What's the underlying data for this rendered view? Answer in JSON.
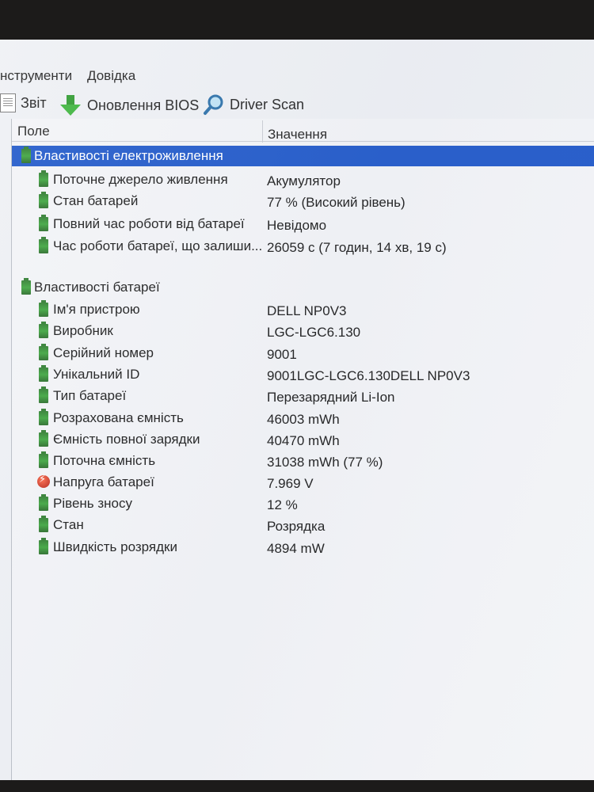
{
  "menu": {
    "tools": "нструменти",
    "help": "Довідка"
  },
  "toolbar": {
    "report": {
      "label": "Звіт",
      "icon": "report-icon"
    },
    "bios_update": {
      "label": "Оновлення BIOS",
      "icon": "download-arrow-icon"
    },
    "driver_scan": {
      "label": "Driver Scan",
      "icon": "magnifier-icon"
    }
  },
  "table": {
    "headers": {
      "field": "Поле",
      "value": "Значення"
    },
    "power_group": {
      "title": "Властивості електроживлення",
      "rows": [
        {
          "field": "Поточне джерело живлення",
          "value": "Акумулятор"
        },
        {
          "field": "Стан батарей",
          "value": "77 % (Високий рівень)"
        },
        {
          "field": "Повний час роботи від батареї",
          "value": "Невідомо"
        },
        {
          "field": "Час роботи батареї, що залиши...",
          "value": "26059 с (7 годин, 14 хв, 19 с)"
        }
      ]
    },
    "battery_group": {
      "title": "Властивості батареї",
      "rows": [
        {
          "field": "Ім'я пристрою",
          "value": "DELL NP0V3"
        },
        {
          "field": "Виробник",
          "value": "LGC-LGC6.130"
        },
        {
          "field": "Серійний номер",
          "value": "9001"
        },
        {
          "field": "Унікальний ID",
          "value": "9001LGC-LGC6.130DELL NP0V3"
        },
        {
          "field": "Тип батареї",
          "value": "Перезарядний Li-Ion"
        },
        {
          "field": "Розрахована ємність",
          "value": "46003 mWh"
        },
        {
          "field": "Ємність повної зарядки",
          "value": "40470 mWh"
        },
        {
          "field": "Поточна ємність",
          "value": "31038 mWh  (77 %)"
        },
        {
          "field": "Напруга батареї",
          "value": "7.969 V"
        },
        {
          "field": "Рівень зносу",
          "value": "12 %"
        },
        {
          "field": "Стан",
          "value": "Розрядка"
        },
        {
          "field": "Швидкість розрядки",
          "value": "4894 mW"
        }
      ]
    }
  },
  "colors": {
    "selection": "#1e57c9",
    "battery_icon": "#3da53d",
    "voltage_icon": "#c0281a",
    "background": "#eef0f4"
  }
}
